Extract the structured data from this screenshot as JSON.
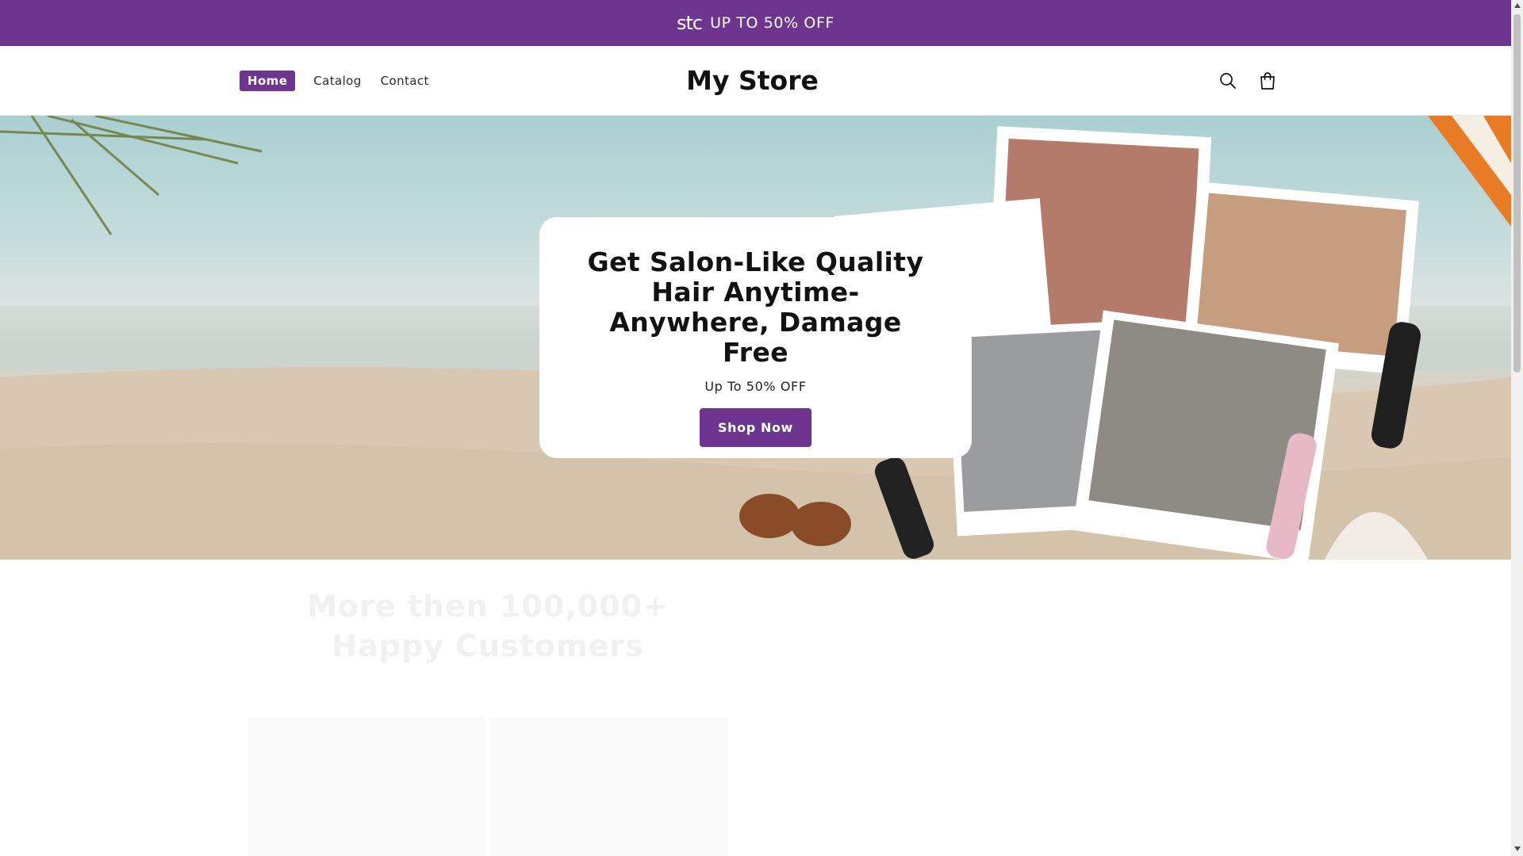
{
  "announcement": {
    "brand": "stc",
    "text": "UP TO 50% OFF"
  },
  "header": {
    "nav": [
      {
        "label": "Home",
        "active": true
      },
      {
        "label": "Catalog",
        "active": false
      },
      {
        "label": "Contact",
        "active": false
      }
    ],
    "logo": "My Store"
  },
  "hero": {
    "title": "Get Salon-Like Quality Hair Anytime- Anywhere, Damage Free",
    "subtitle": "Up To 50% OFF",
    "cta_label": "Shop Now"
  },
  "section": {
    "title": "More then 100,000+ Happy Customers"
  },
  "colors": {
    "accent": "#6e3590"
  }
}
